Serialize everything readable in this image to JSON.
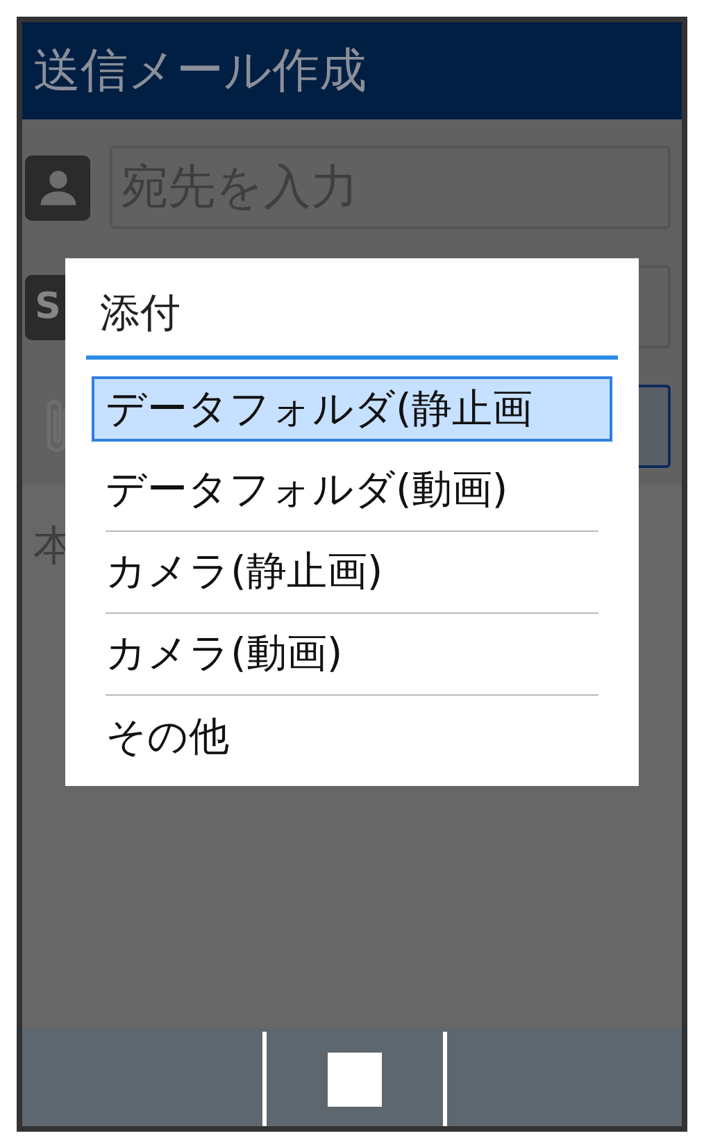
{
  "title_bar": {
    "title": "送信メール作成"
  },
  "form": {
    "to_field": {
      "placeholder": "宛先を入力"
    },
    "subject_icon": "S",
    "attachment_field": {
      "focused": true
    },
    "body_label": "本"
  },
  "dialog": {
    "title": "添付",
    "items": [
      {
        "label": "データフォルダ(静止画",
        "selected": true
      },
      {
        "label": "データフォルダ(動画)",
        "selected": false
      },
      {
        "label": "カメラ(静止画)",
        "selected": false
      },
      {
        "label": "カメラ(動画)",
        "selected": false
      },
      {
        "label": "その他",
        "selected": false
      }
    ]
  }
}
